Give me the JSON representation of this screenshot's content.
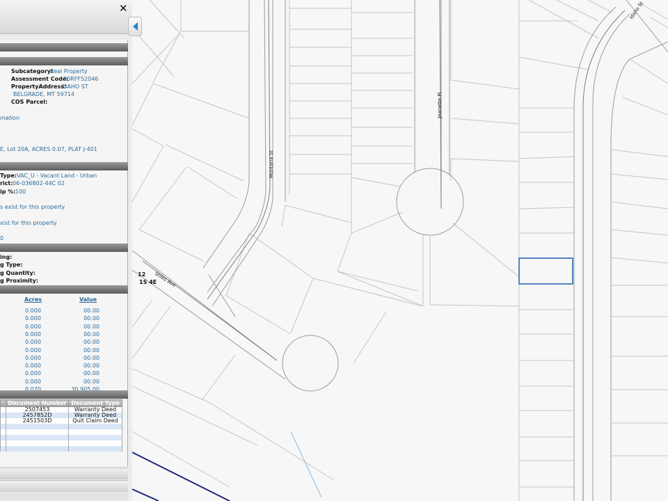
{
  "panel": {
    "close_glyph": "✕",
    "details": {
      "subcategory_label": "Subcategory:",
      "subcategory_value": "Real Property",
      "assessment_code_label": "Assessment Code:",
      "assessment_code_value": "00RFF52046",
      "property_address_label": "PropertyAddress:",
      "property_address_line1": "IDAHO ST",
      "property_address_line2": "BELGRADE, MT 59714",
      "cos_parcel_label": "COS Parcel:",
      "mation_text": "mation",
      "legal_text": "E, Lot 20A, ACRES 0.07, PLAT J-401"
    },
    "land": {
      "type_label": "Type:",
      "type_value": "VAC_U - Vacant Land - Urban",
      "district_label": "rict:",
      "district_value": "06-036802-44C 02",
      "ownership_label": "ip %:",
      "ownership_value": "100",
      "link1": "s exist for this property",
      "link2": "xist for this property",
      "trunc_link": "0"
    },
    "parking": {
      "line1": "ing:",
      "line2": "g Type:",
      "line3": "g Quantity:",
      "line4": "g Proximity:"
    },
    "acres_table": {
      "acres_header": "Acres",
      "value_header": "Value",
      "rows": [
        {
          "acres": "0.000",
          "value": "00.00"
        },
        {
          "acres": "0.000",
          "value": "00.00"
        },
        {
          "acres": "0.000",
          "value": "00.00"
        },
        {
          "acres": "0.000",
          "value": "00.00"
        },
        {
          "acres": "0.000",
          "value": "00.00"
        },
        {
          "acres": "0.000",
          "value": "00.00"
        },
        {
          "acres": "0.000",
          "value": "00.00"
        },
        {
          "acres": "0.000",
          "value": "00.00"
        },
        {
          "acres": "0.000",
          "value": "00.00"
        },
        {
          "acres": "0.000",
          "value": "00.00"
        },
        {
          "acres": "0.070",
          "value": "30,905.00"
        }
      ]
    },
    "documents": {
      "document_number_header": "Document Number",
      "document_type_header": "Document Type",
      "rows": [
        {
          "number": "2507453",
          "type": "Warranty Deed"
        },
        {
          "number": "2457852D",
          "type": "Warranty Deed"
        },
        {
          "number": "2451503D",
          "type": "Quit Claim Deed"
        }
      ]
    }
  },
  "map": {
    "streets": {
      "montana": "Montana St",
      "jeanette": "Jeanette Pl",
      "idaho": "Idaho St",
      "stiles": "Stiles Ave"
    },
    "section_number": "12",
    "township_range": "1S 4E",
    "colors": {
      "parcel_line": "#c4c4c4",
      "road_edge": "#9a9a9a",
      "selection": "#1f5fb0",
      "boundary": "#1a2a7a",
      "stream": "#8ab8e0"
    }
  }
}
